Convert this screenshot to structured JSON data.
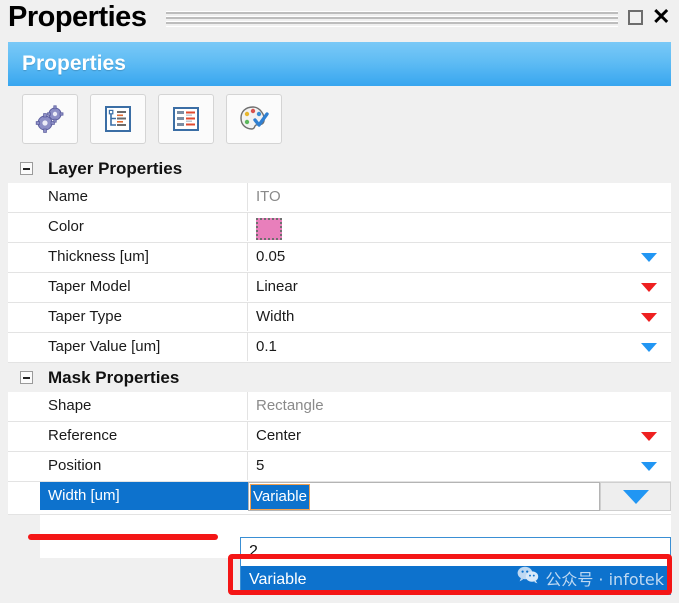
{
  "window": {
    "title": "Properties",
    "maximize_label": "maximize",
    "close_label": "✕"
  },
  "header": {
    "title": "Properties"
  },
  "toolbar": {
    "buttons": [
      {
        "name": "gears-icon",
        "tooltip": "Settings"
      },
      {
        "name": "tree-view-icon",
        "tooltip": "Categorized"
      },
      {
        "name": "list-view-icon",
        "tooltip": "Alphabetical"
      },
      {
        "name": "palette-icon",
        "tooltip": "Property Pages"
      }
    ]
  },
  "groups": [
    {
      "title": "Layer Properties",
      "expanded": true,
      "rows": [
        {
          "label": "Name",
          "value": "ITO",
          "kind": "readonly",
          "arrow": "none"
        },
        {
          "label": "Color",
          "value": "",
          "kind": "color",
          "swatch": "#e87fbb",
          "arrow": "none"
        },
        {
          "label": "Thickness [um]",
          "value": "0.05",
          "kind": "text",
          "arrow": "blue"
        },
        {
          "label": "Taper Model",
          "value": "Linear",
          "kind": "text",
          "arrow": "red"
        },
        {
          "label": "Taper Type",
          "value": "Width",
          "kind": "text",
          "arrow": "red"
        },
        {
          "label": "Taper Value [um]",
          "value": "0.1",
          "kind": "text",
          "arrow": "blue"
        }
      ]
    },
    {
      "title": "Mask Properties",
      "expanded": true,
      "rows": [
        {
          "label": "Shape",
          "value": "Rectangle",
          "kind": "readonly",
          "arrow": "none"
        },
        {
          "label": "Reference",
          "value": "Center",
          "kind": "text",
          "arrow": "red"
        },
        {
          "label": "Position",
          "value": "5",
          "kind": "text",
          "arrow": "blue"
        }
      ]
    }
  ],
  "editing_row": {
    "label": "Width [um]",
    "value": "Variable",
    "selected": true
  },
  "dropdown": {
    "open": true,
    "options": [
      {
        "label": "2",
        "selected": false
      },
      {
        "label": "Variable",
        "selected": true
      }
    ],
    "watermark": "公众号 · infotek"
  },
  "colors": {
    "accent_blue": "#0d72cd",
    "header_blue": "#5fbcf4",
    "arrow_blue": "#2196f3",
    "arrow_red": "#ee2020",
    "annotation_red": "#f41616",
    "swatch_pink": "#e87fbb"
  }
}
